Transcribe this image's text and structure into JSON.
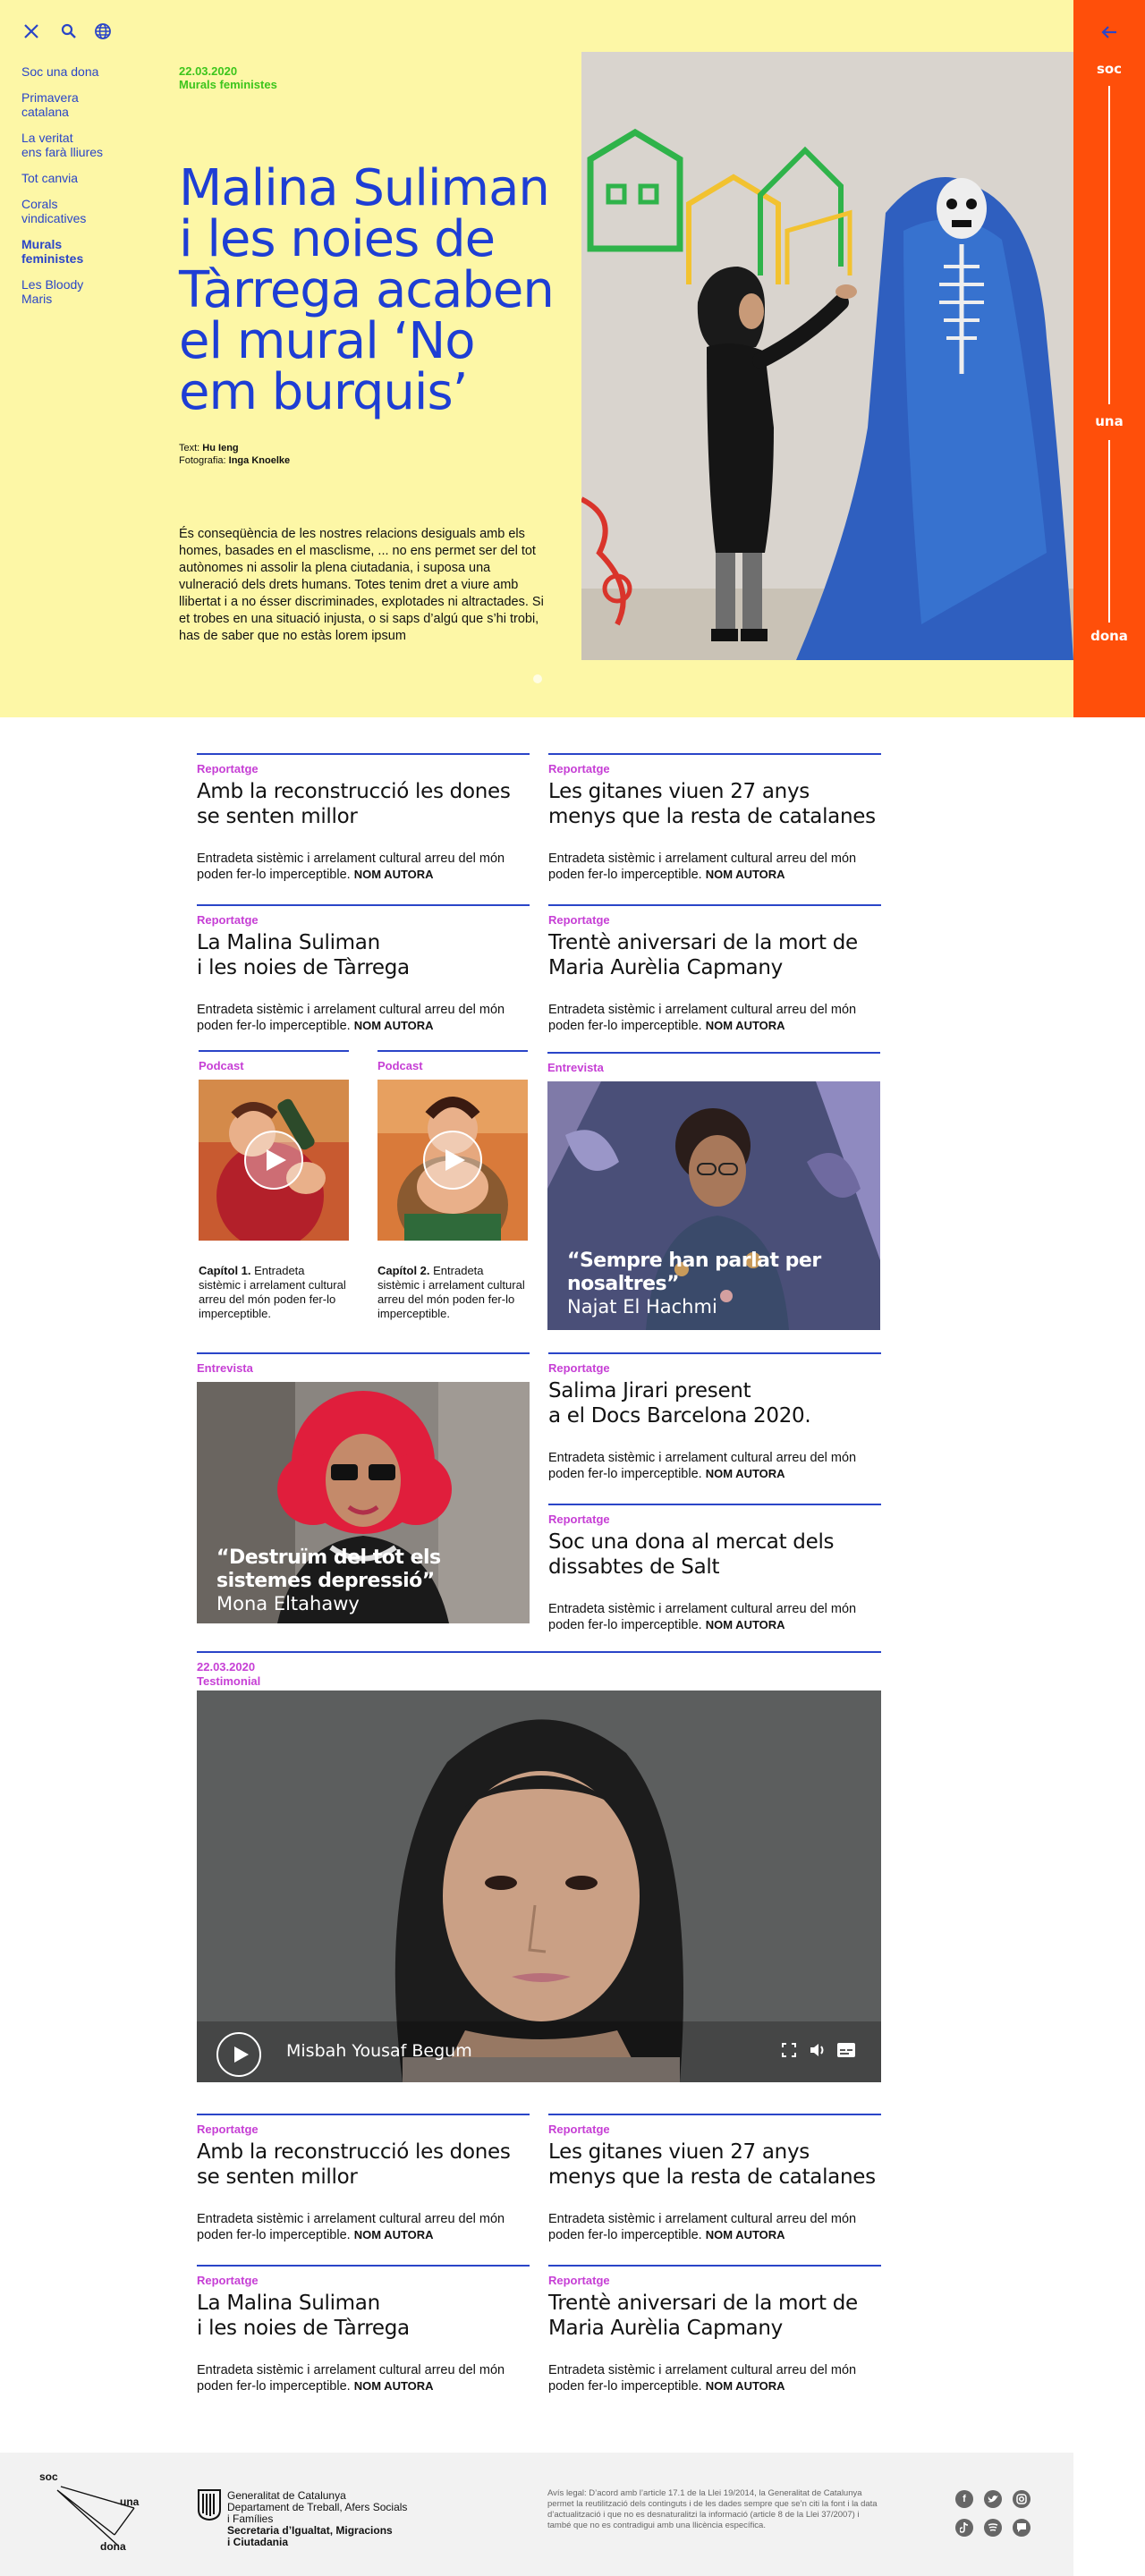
{
  "topbar": {
    "close_icon": "close-icon",
    "search_icon": "search-icon",
    "language_icon": "globe-icon"
  },
  "sidebar": {
    "items": [
      {
        "label": "Soc una dona"
      },
      {
        "label": "Primavera\ncatalana"
      },
      {
        "label": "La veritat\nens farà lliures"
      },
      {
        "label": "Tot canvia"
      },
      {
        "label": "Corals\nvindicatives"
      },
      {
        "label": "Murals\nfeministes",
        "active": true
      },
      {
        "label": "Les Bloody\nMaris"
      }
    ]
  },
  "hero": {
    "date": "22.03.2020",
    "section": "Murals feministes",
    "title": "Malina Suliman i les noies de Tàrrega acaben el mural ‘No em burquis’",
    "text_label": "Text:",
    "text_author": "Hu Ieng",
    "photo_label": "Fotografia:",
    "photo_author": "Inga Knoelke",
    "body": "És conseqüència de les nostres relacions desiguals amb els homes, basades en el masclisme, ... no ens permet ser del tot autònomes ni assolir la plena ciutadania, i suposa una vulneració dels drets humans. Totes tenim dret a viure amb llibertat i a no ésser discriminades, explotades ni altractades. Si et trobes en una situació injusta, o si saps d’algú que s’hi trobi, has de saber que no estàs lorem ipsum"
  },
  "rightbar": {
    "word1": "soc",
    "word2": "una",
    "word3": "dona",
    "back_icon": "arrow-left-icon"
  },
  "cards_top": [
    {
      "cat": "Reportatge",
      "title": "Amb la reconstrucció les dones se senten millor",
      "desc": "Entradeta sistèmic i arrelament cultural arreu del món poden fer-lo imperceptible.",
      "author": "NOM AUTORA"
    },
    {
      "cat": "Reportatge",
      "title": "Les gitanes viuen 27 anys menys que la resta de catalanes",
      "desc": "Entradeta sistèmic i arrelament cultural arreu del món poden fer-lo imperceptible.",
      "author": "NOM AUTORA"
    },
    {
      "cat": "Reportatge",
      "title": "La Malina Suliman\ni les noies de Tàrrega",
      "desc": "Entradeta sistèmic i arrelament cultural arreu del món poden fer-lo imperceptible.",
      "author": "NOM AUTORA"
    },
    {
      "cat": "Reportatge",
      "title": "Trentè aniversari de la mort de Maria Aurèlia Capmany",
      "desc": "Entradeta sistèmic i arrelament cultural arreu del món poden fer-lo imperceptible.",
      "author": "NOM AUTORA"
    }
  ],
  "podcasts": [
    {
      "cat": "Podcast",
      "chapter": "Capítol 1.",
      "desc": "Entradeta sistèmic i arrelament cultural arreu del món poden fer-lo imperceptible."
    },
    {
      "cat": "Podcast",
      "chapter": "Capítol 2.",
      "desc": "Entradeta sistèmic i arrelament cultural arreu del món poden fer-lo imperceptible."
    }
  ],
  "interview1": {
    "cat": "Entrevista",
    "quote": "“Sempre han parlat per nosaltres”",
    "name": "Najat El Hachmi"
  },
  "interview2": {
    "cat": "Entrevista",
    "quote": "“Destruïm del tot els sistemes depressió”",
    "name": "Mona Eltahawy"
  },
  "cards_mid": [
    {
      "cat": "Reportatge",
      "title": "Salima Jirari present\na el Docs Barcelona 2020.",
      "desc": "Entradeta sistèmic i arrelament cultural arreu del món poden fer-lo imperceptible.",
      "author": "NOM AUTORA"
    },
    {
      "cat": "Reportatge",
      "title": "Soc una dona al mercat dels dissabtes de Salt",
      "desc": "Entradeta sistèmic i arrelament cultural arreu del món poden fer-lo imperceptible.",
      "author": "NOM AUTORA"
    }
  ],
  "video": {
    "date": "22.03.2020",
    "cat": "Testimonial",
    "name": "Misbah Yousaf Begum"
  },
  "cards_bottom": [
    {
      "cat": "Reportatge",
      "title": "Amb la reconstrucció les dones se senten millor",
      "desc": "Entradeta sistèmic i arrelament cultural arreu del món poden fer-lo imperceptible.",
      "author": "NOM AUTORA"
    },
    {
      "cat": "Reportatge",
      "title": "Les gitanes viuen 27 anys menys que la resta de catalanes",
      "desc": "Entradeta sistèmic i arrelament cultural arreu del món poden fer-lo imperceptible.",
      "author": "NOM AUTORA"
    },
    {
      "cat": "Reportatge",
      "title": "La Malina Suliman\ni les noies de Tàrrega",
      "desc": "Entradeta sistèmic i arrelament cultural arreu del món poden fer-lo imperceptible.",
      "author": "NOM AUTORA"
    },
    {
      "cat": "Reportatge",
      "title": "Trentè aniversari de la mort de Maria Aurèlia Capmany",
      "desc": "Entradeta sistèmic i arrelament cultural arreu del món poden fer-lo imperceptible.",
      "author": "NOM AUTORA"
    }
  ],
  "footer": {
    "logo_soc": "soc",
    "logo_una": "una",
    "logo_dona": "dona",
    "gen_line1": "Generalitat de Catalunya",
    "gen_line2": "Departament de Treball, Afers Socials",
    "gen_line3": "i Famílies",
    "gen_line4": "Secretaria d’Igualtat, Migracions",
    "gen_line5": "i Ciutadania",
    "legal": "Avís legal: D’acord amb l’article 17.1 de la Llei 19/2014, la Generalitat de Catalunya permet la reutilització dels continguts i de les dades sempre que se’n citi la font i la data d’actualització i que no es desnaturalitzi la informació (article 8 de la Llei 37/2007) i també que no es contradigui amb una llicència específica.",
    "social": [
      "facebook-icon",
      "twitter-icon",
      "instagram-icon",
      "tiktok-icon",
      "spotify-icon",
      "chat-icon"
    ]
  },
  "colors": {
    "hero_bg": "#fdf7a6",
    "accent_blue": "#1e3ed4",
    "orange": "#ff4f0a",
    "magenta": "#c63fd5",
    "green": "#3cc51c"
  }
}
